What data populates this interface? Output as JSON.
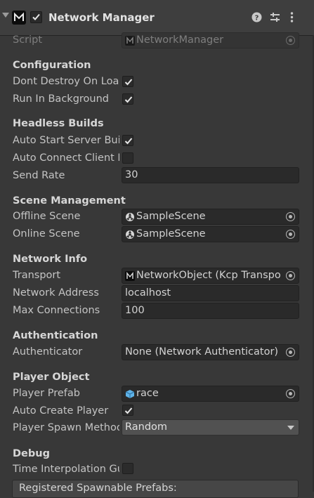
{
  "header": {
    "title": "Network Manager",
    "enabled": true
  },
  "script": {
    "label": "Script",
    "value": "NetworkManager"
  },
  "configuration": {
    "title": "Configuration",
    "dont_destroy": {
      "label": "Dont Destroy On Load",
      "checked": true
    },
    "run_background": {
      "label": "Run In Background",
      "checked": true
    }
  },
  "headless": {
    "title": "Headless Builds",
    "auto_start_server": {
      "label": "Auto Start Server Build",
      "checked": true
    },
    "auto_connect_client": {
      "label": "Auto Connect Client Build",
      "checked": false
    },
    "send_rate": {
      "label": "Send Rate",
      "value": "30"
    }
  },
  "scene": {
    "title": "Scene Management",
    "offline": {
      "label": "Offline Scene",
      "value": "SampleScene"
    },
    "online": {
      "label": "Online Scene",
      "value": "SampleScene"
    }
  },
  "network": {
    "title": "Network Info",
    "transport": {
      "label": "Transport",
      "value": "NetworkObject (Kcp Transport)"
    },
    "address": {
      "label": "Network Address",
      "value": "localhost"
    },
    "max_connections": {
      "label": "Max Connections",
      "value": "100"
    }
  },
  "auth": {
    "title": "Authentication",
    "authenticator": {
      "label": "Authenticator",
      "value": "None (Network Authenticator)"
    }
  },
  "player": {
    "title": "Player Object",
    "prefab": {
      "label": "Player Prefab",
      "value": "race"
    },
    "auto_create": {
      "label": "Auto Create Player",
      "checked": true
    },
    "spawn_method": {
      "label": "Player Spawn Method",
      "value": "Random"
    }
  },
  "debug": {
    "title": "Debug",
    "time_interpolation": {
      "label": "Time Interpolation Gui",
      "checked": false
    }
  },
  "spawnable": {
    "label": "Registered Spawnable Prefabs:"
  },
  "colors": {
    "background": "#383838",
    "field": "#2a2a2a",
    "text": "#c4c4c4"
  }
}
